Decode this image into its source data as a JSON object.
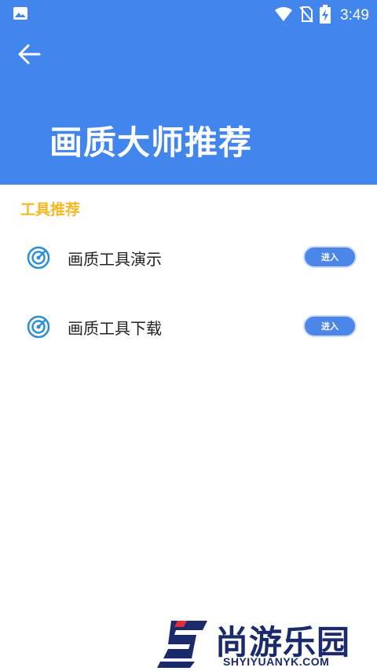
{
  "status_bar": {
    "time": "3:49",
    "icons": [
      "image-icon",
      "wifi-icon",
      "no-sim-icon",
      "battery-charging-icon"
    ]
  },
  "header": {
    "back_icon": "arrow-left-icon",
    "title": "画质大师推荐",
    "background_color": "#4285ec"
  },
  "section": {
    "title": "工具推荐",
    "title_color": "#f5b923"
  },
  "items": [
    {
      "icon": "radar-target-icon",
      "label": "画质工具演示",
      "button_label": "进入"
    },
    {
      "icon": "radar-target-icon",
      "label": "画质工具下载",
      "button_label": "进入"
    }
  ],
  "watermark": {
    "text": "尚游乐园",
    "url": "SHYIYUANYK.COM"
  }
}
